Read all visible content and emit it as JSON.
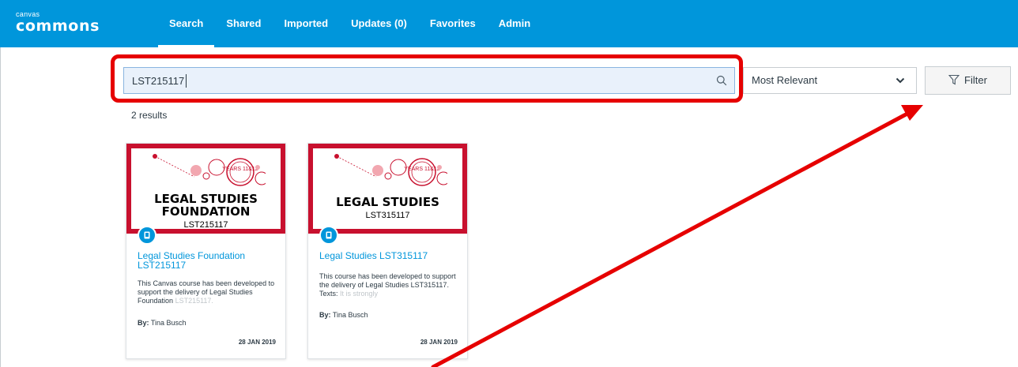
{
  "app": {
    "logo_small": "canvas",
    "logo_big": "commons"
  },
  "nav": {
    "items": [
      {
        "label": "Search",
        "active": true
      },
      {
        "label": "Shared"
      },
      {
        "label": "Imported"
      },
      {
        "label": "Updates (0)"
      },
      {
        "label": "Favorites"
      },
      {
        "label": "Admin"
      }
    ]
  },
  "search": {
    "value": "LST215117",
    "icon": "search-icon"
  },
  "sort": {
    "selected": "Most Relevant",
    "icon": "chevron-down-icon"
  },
  "filter": {
    "label": "Filter",
    "icon": "funnel-icon"
  },
  "results": {
    "count_text": "2 results"
  },
  "cards": [
    {
      "thumb_title_line1": "LEGAL STUDIES",
      "thumb_title_line2": "FOUNDATION",
      "thumb_code": "LST215117",
      "thumb_years": "YEARS 11&12",
      "title": "Legal Studies Foundation LST215117",
      "desc": "This Canvas course has been developed to support the delivery of Legal Studies Foundation",
      "desc_fade": "LST215117.",
      "by_label": "By:",
      "author": "Tina Busch",
      "date": "28 JAN 2019"
    },
    {
      "thumb_title_line1": "LEGAL STUDIES",
      "thumb_code": "LST315117",
      "thumb_years": "YEARS 11&12",
      "title": "Legal Studies LST315117",
      "desc": "This course has been developed to support the delivery of Legal Studies LST315117. Texts:",
      "desc_fade": "It is strongly",
      "by_label": "By:",
      "author": "Tina Busch",
      "date": "28 JAN 2019"
    }
  ],
  "colors": {
    "brand": "#0096db",
    "annotation": "#e60000",
    "card_border": "#c8102e"
  }
}
